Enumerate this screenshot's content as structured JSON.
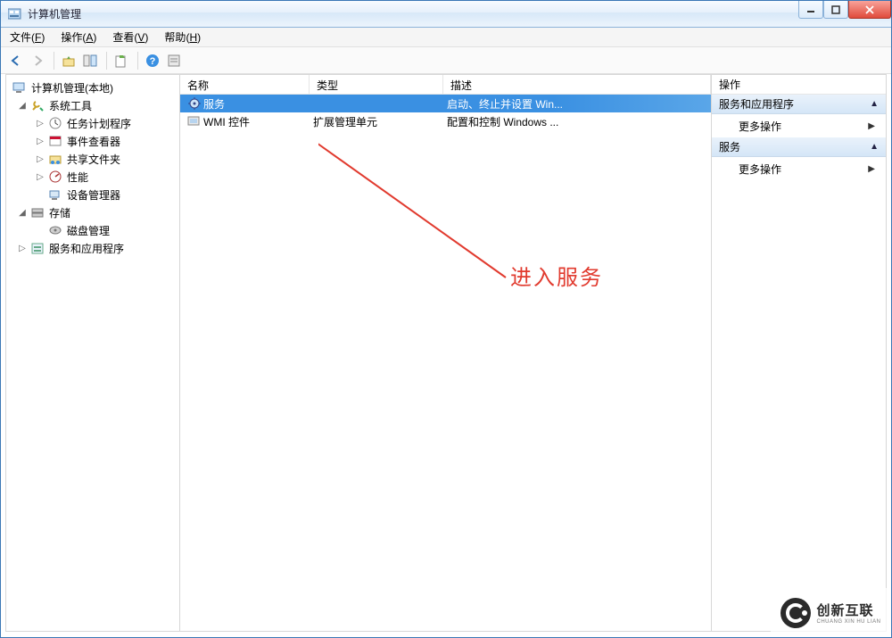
{
  "window": {
    "title": "计算机管理"
  },
  "menu": {
    "file": {
      "label": "文件",
      "accel": "F"
    },
    "action": {
      "label": "操作",
      "accel": "A"
    },
    "view": {
      "label": "查看",
      "accel": "V"
    },
    "help": {
      "label": "帮助",
      "accel": "H"
    }
  },
  "tree": {
    "root": "计算机管理(本地)",
    "sys": "系统工具",
    "task": "任务计划程序",
    "event": "事件查看器",
    "share": "共享文件夹",
    "perf": "性能",
    "devmgr": "设备管理器",
    "storage": "存储",
    "disk": "磁盘管理",
    "svcapp": "服务和应用程序"
  },
  "list": {
    "cols": {
      "name": "名称",
      "type": "类型",
      "desc": "描述"
    },
    "rows": [
      {
        "name": "服务",
        "type": "",
        "desc": "启动、终止并设置 Win...",
        "selected": true,
        "icon": "gear"
      },
      {
        "name": "WMI 控件",
        "type": "扩展管理单元",
        "desc": "配置和控制 Windows ...",
        "selected": false,
        "icon": "wmi"
      }
    ]
  },
  "actions": {
    "title": "操作",
    "group1": "服务和应用程序",
    "more": "更多操作",
    "group2": "服务"
  },
  "annotation": {
    "text": "进入服务"
  },
  "watermark": {
    "big": "创新互联",
    "small": "CHUANG XIN HU LIAN"
  }
}
